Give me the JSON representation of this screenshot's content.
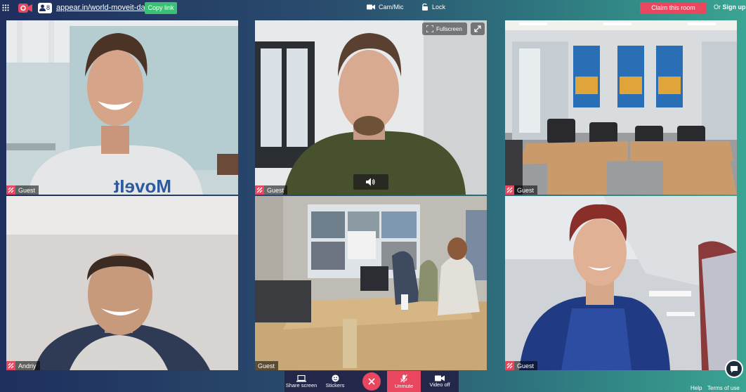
{
  "topbar": {
    "room_url": "appear.in/world-moveit-day",
    "participant_count": "8",
    "copy_link_label": "Copy link",
    "cam_mic_label": "Cam/Mic",
    "lock_label": "Lock",
    "claim_room_label": "Claim this room",
    "or_label": "Or",
    "sign_up_label": "Sign up"
  },
  "tiles": [
    {
      "name": "Guest"
    },
    {
      "name": "Guest"
    },
    {
      "name": "Guest"
    },
    {
      "name": "Andriy"
    },
    {
      "name": "Guest"
    },
    {
      "name": "Guest"
    }
  ],
  "tile_controls": {
    "fullscreen_label": "Fullscreen"
  },
  "shirt_text": "MoveIt",
  "controls": {
    "share_screen": "Share screen",
    "stickers": "Stickers",
    "unmute": "Unmute",
    "video_off": "Video off"
  },
  "footer": {
    "help": "Help",
    "terms": "Terms of use"
  },
  "colors": {
    "accent": "#e8475f",
    "copy_button": "#3bbf72",
    "controls_bg": "#23284a"
  }
}
